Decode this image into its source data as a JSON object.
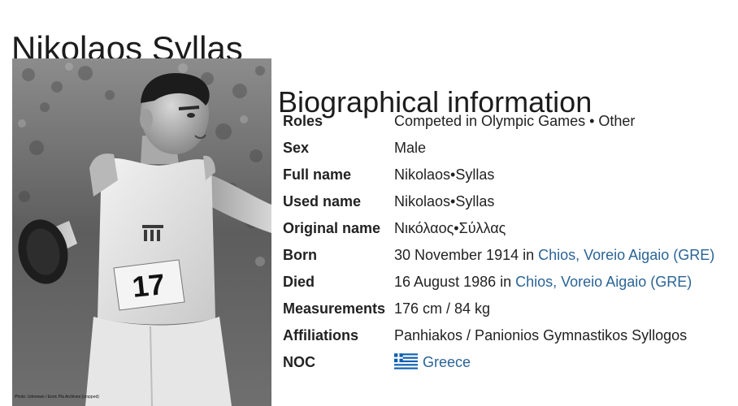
{
  "page": {
    "title": "Nikolaos Syllas"
  },
  "photo": {
    "credit": "Photo: Unknown / Enric Pla Archives (cropped)",
    "bib": "17"
  },
  "bio": {
    "section_title": "Biographical information",
    "rows": [
      {
        "label": "Roles",
        "value": "Competed in Olympic Games • Other"
      },
      {
        "label": "Sex",
        "value": "Male"
      },
      {
        "label": "Full name",
        "value": "Nikolaos•Syllas"
      },
      {
        "label": "Used name",
        "value": "Nikolaos•Syllas"
      },
      {
        "label": "Original name",
        "value": "Νικόλαος•Σύλλας"
      },
      {
        "label": "Born",
        "prefix": "30 November 1914 in ",
        "link": "Chios, Voreio Aigaio (GRE)"
      },
      {
        "label": "Died",
        "prefix": "16 August 1986 in ",
        "link": "Chios, Voreio Aigaio (GRE)"
      },
      {
        "label": "Measurements",
        "value": "176 cm / 84 kg"
      },
      {
        "label": "Affiliations",
        "value": "Panhiakos / Panionios Gymnastikos Syllogos"
      },
      {
        "label": "NOC",
        "link": "Greece",
        "flag_icon": "greece-flag-icon"
      }
    ]
  },
  "colors": {
    "link": "#2a6496",
    "text": "#222222",
    "flag_blue": "#0d5eaf"
  }
}
